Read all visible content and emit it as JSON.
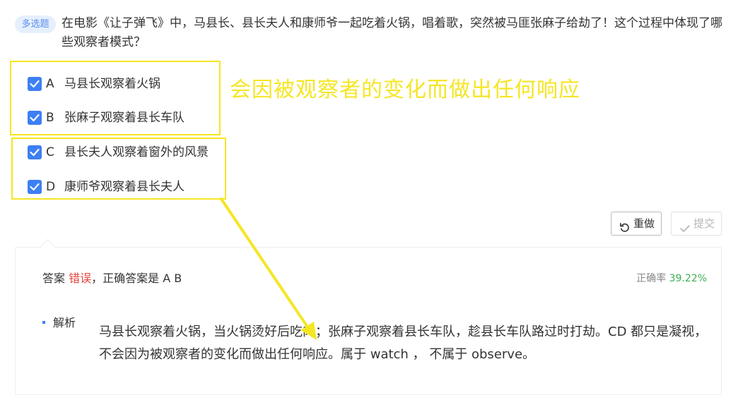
{
  "question": {
    "type_badge": "多选题",
    "text": "在电影《让子弹飞》中，马县长、县长夫人和康师爷一起吃着火锅，唱着歌，突然被马匪张麻子给劫了！这个过程中体现了哪些观察者模式？"
  },
  "options": [
    {
      "letter": "A",
      "text": "马县长观察着火锅",
      "checked": true
    },
    {
      "letter": "B",
      "text": "张麻子观察着县长车队",
      "checked": true
    },
    {
      "letter": "C",
      "text": "县长夫人观察着窗外的风景",
      "checked": true
    },
    {
      "letter": "D",
      "text": "康师爷观察着县长夫人",
      "checked": true
    }
  ],
  "annotation": {
    "text": "会因被观察者的变化而做出任何响应",
    "color": "#f5e623"
  },
  "buttons": {
    "redo_label": "重做",
    "submit_label": "提交"
  },
  "result": {
    "answer_prefix": "答案",
    "status": "错误",
    "correct_prefix": "，正确答案是 A B",
    "accuracy_label": "正确率",
    "accuracy_value": "39.22%"
  },
  "analysis": {
    "title": "解析",
    "text": "马县长观察着火锅，当火锅烫好后吃肉；张麻子观察着县长车队，趁县长车队路过时打劫。CD 都只是凝视，不会因为被观察者的变化而做出任何响应。属于 watch ， 不属于 observe。"
  },
  "colors": {
    "accent": "#3d7ff5",
    "error": "#e4453a",
    "success": "#3fae55",
    "highlight": "#f5e623"
  }
}
